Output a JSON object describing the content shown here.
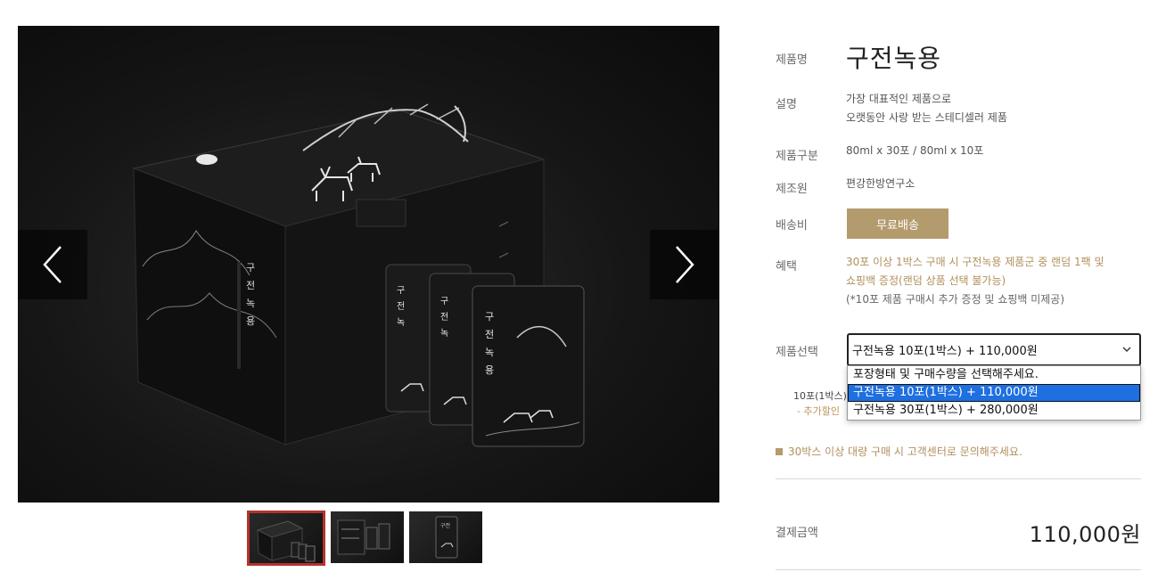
{
  "gallery": {
    "prev_icon": "chevron-left-icon",
    "next_icon": "chevron-right-icon",
    "thumbnails": [
      "thumbnail-1",
      "thumbnail-2",
      "thumbnail-3"
    ],
    "active_thumbnail_index": 0
  },
  "product": {
    "name_label": "제품명",
    "name": "구전녹용",
    "desc_label": "설명",
    "desc_line1": "가장 대표적인 제품으로",
    "desc_line2": "오랫동안 사랑 받는 스테디셀러 제품",
    "type_label": "제품구분",
    "type_value": "80ml x 30포 / 80ml x 10포",
    "maker_label": "제조원",
    "maker_value": "편강한방연구소",
    "shipping_label": "배송비",
    "shipping_badge": "무료배송",
    "benefit_label": "혜택",
    "benefit_line1": "30포 이상 1박스 구매 시 구전녹용 제품군 중 랜덤 1팩 및",
    "benefit_line2": "쇼핑백 증정(랜덤 상품 선택 불가능)",
    "benefit_line3": "(*10포 제품 구매시 추가 증정 및 쇼핑백 미제공)"
  },
  "select": {
    "label": "제품선택",
    "current": "구전녹용 10포(1박스)  + 110,000원",
    "options": [
      "포장형태 및 구매수량을 선택해주세요.",
      "구전녹용 10포(1박스)  + 110,000원",
      "구전녹용 30포(1박스)  + 280,000원"
    ],
    "highlighted_index": 1
  },
  "partial": {
    "row1": "10포(1박스)",
    "row2": "- 추가할인"
  },
  "notice": "30박스 이상 대량 구매 시 고객센터로 문의해주세요.",
  "payment": {
    "label": "결제금액",
    "amount": "110,000원"
  },
  "colors": {
    "accent_gold": "#b39b6d",
    "benefit_text": "#b0905c",
    "active_thumb_border": "#b4322c",
    "option_highlight": "#1e6fe0"
  }
}
